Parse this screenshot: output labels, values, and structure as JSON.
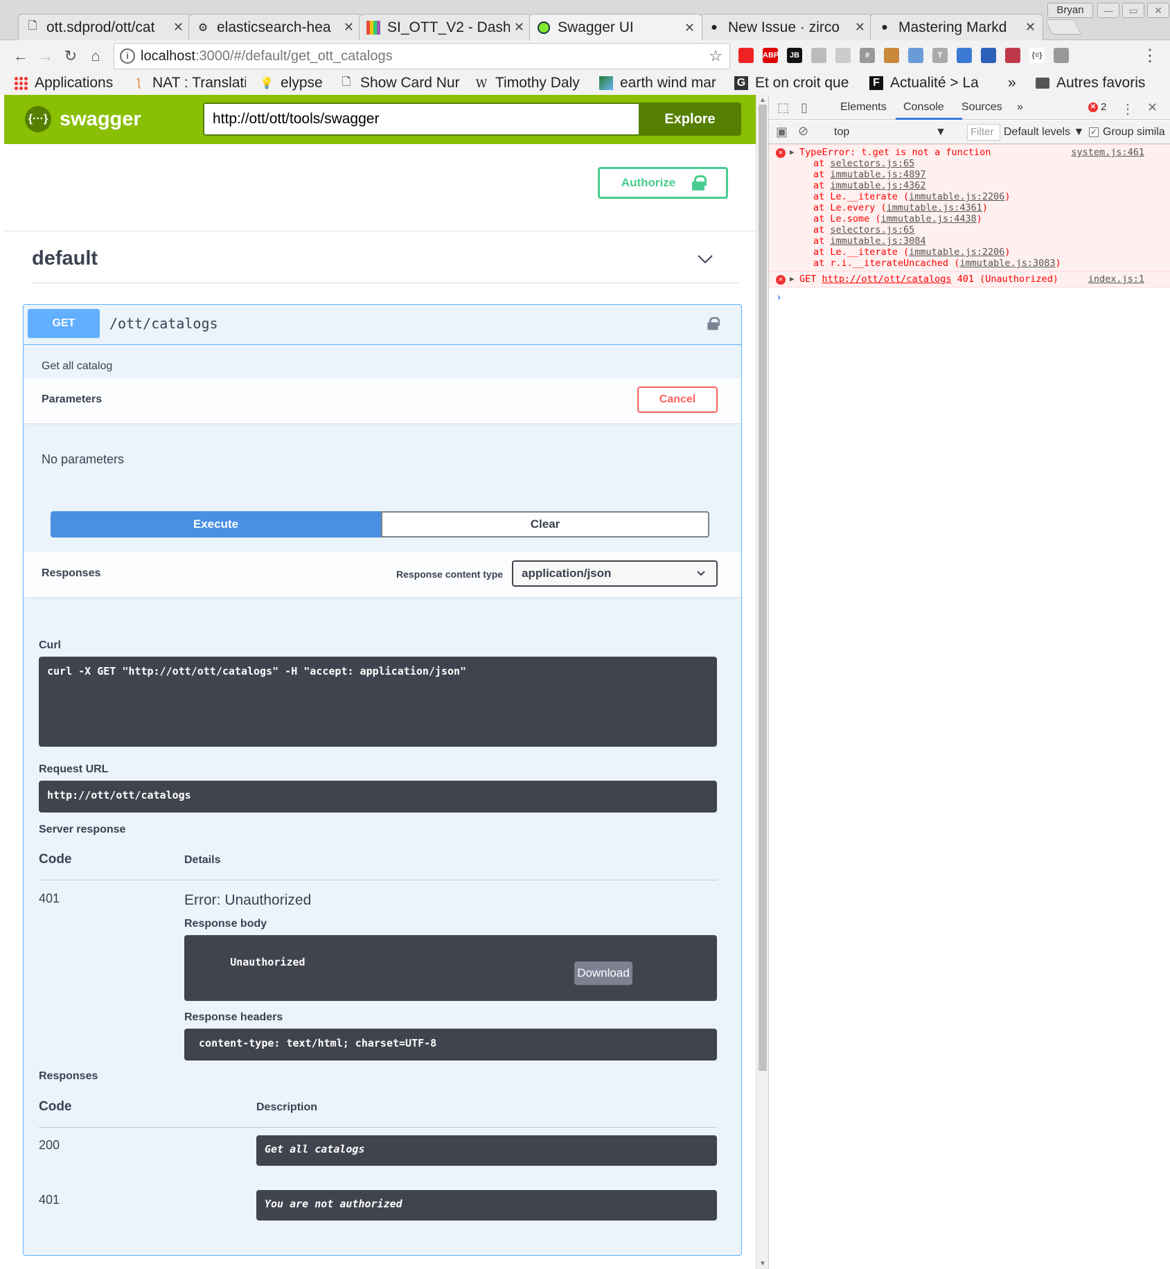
{
  "browser": {
    "tabs": [
      {
        "title": "ott.sdprod/ott/cat",
        "icon": "document-icon"
      },
      {
        "title": "elasticsearch-hea",
        "icon": "elasticsearch-icon"
      },
      {
        "title": "SI_OTT_V2 - Dash",
        "icon": "dashboard-icon"
      },
      {
        "title": "Swagger UI",
        "icon": "swagger-icon",
        "active": true
      },
      {
        "title": "New Issue · zirco",
        "icon": "github-icon"
      },
      {
        "title": "Mastering Markd",
        "icon": "github-icon"
      }
    ],
    "user": "Bryan",
    "address": {
      "host": "localhost",
      "path": ":3000/#/default/get_ott_catalogs"
    },
    "bookmarks": [
      {
        "label": "Applications",
        "icon": "apps-grid-icon"
      },
      {
        "label": "NAT : Translatio",
        "icon": "nat-icon"
      },
      {
        "label": "elypse",
        "icon": "bulb-icon"
      },
      {
        "label": "Show Card Nur",
        "icon": "document-icon"
      },
      {
        "label": "Timothy Daly",
        "icon": "wikipedia-icon"
      },
      {
        "label": "earth wind mar",
        "icon": "earth-icon"
      },
      {
        "label": "Et on croit que",
        "icon": "google-icon"
      },
      {
        "label": "Actualité > La",
        "icon": "f-icon"
      },
      {
        "label": "Autres favoris",
        "icon": "folder-icon"
      }
    ],
    "more_bookmarks": "»",
    "extensions": [
      {
        "label": "",
        "color": "#e22"
      },
      {
        "label": "ABP",
        "color": "#d00"
      },
      {
        "label": "JB",
        "color": "#111"
      },
      {
        "label": "",
        "color": "#bbb"
      },
      {
        "label": "",
        "color": "#ccc"
      },
      {
        "label": "#",
        "color": "#999"
      },
      {
        "label": "",
        "color": "#c8893a"
      },
      {
        "label": "",
        "color": "#6a9bd8"
      },
      {
        "label": "T",
        "color": "#aaa"
      },
      {
        "label": "",
        "color": "#3a7bd5"
      },
      {
        "label": "",
        "color": "#2c5fb8"
      },
      {
        "label": "",
        "color": "#c0394b"
      },
      {
        "label": "{≡}",
        "color": "#fff"
      },
      {
        "label": "",
        "color": "#999"
      }
    ]
  },
  "swagger": {
    "brand": "swagger",
    "spec_url": "http://ott/ott/tools/swagger",
    "explore_label": "Explore",
    "authorize_label": "Authorize",
    "tag": "default",
    "operation": {
      "method": "GET",
      "path": "/ott/catalogs",
      "summary": "Get all catalog",
      "parameters_title": "Parameters",
      "cancel_label": "Cancel",
      "no_params": "No parameters",
      "execute_label": "Execute",
      "clear_label": "Clear",
      "responses_title": "Responses",
      "response_content_type_label": "Response content type",
      "response_content_type": "application/json",
      "curl_label": "Curl",
      "curl": "curl -X GET \"http://ott/ott/catalogs\" -H \"accept: application/json\"",
      "request_url_label": "Request URL",
      "request_url": "http://ott/ott/catalogs",
      "server_response_label": "Server response",
      "code_header": "Code",
      "details_header": "Details",
      "server_code": "401",
      "server_error": "Error: Unauthorized",
      "response_body_label": "Response body",
      "response_body": "Unauthorized",
      "download_label": "Download",
      "response_headers_label": "Response headers",
      "response_headers": " content-type: text/html; charset=UTF-8 ",
      "responses_label": "Responses",
      "description_header": "Description",
      "responses": [
        {
          "code": "200",
          "description": "Get all catalogs"
        },
        {
          "code": "401",
          "description": "You are not authorized"
        }
      ]
    }
  },
  "devtools": {
    "tabs": [
      "Elements",
      "Console",
      "Sources"
    ],
    "more": "»",
    "error_count": "2",
    "context": "top",
    "filter_placeholder": "Filter",
    "levels": "Default levels ▼",
    "group_similar": "Group simila",
    "messages": [
      {
        "text": "TypeError: t.get is not a function",
        "source": "system.js:461",
        "stack": [
          [
            "at ",
            "selectors.js:65",
            ""
          ],
          [
            "at ",
            "immutable.js:4897",
            ""
          ],
          [
            "at ",
            "immutable.js:4362",
            ""
          ],
          [
            "at Le.__iterate (",
            "immutable.js:2206",
            ")"
          ],
          [
            "at Le.every (",
            "immutable.js:4361",
            ")"
          ],
          [
            "at Le.some (",
            "immutable.js:4438",
            ")"
          ],
          [
            "at ",
            "selectors.js:65",
            ""
          ],
          [
            "at ",
            "immutable.js:3084",
            ""
          ],
          [
            "at Le.__iterate (",
            "immutable.js:2206",
            ")"
          ],
          [
            "at r.i.__iterateUncached (",
            "immutable.js:3083",
            ")"
          ]
        ]
      },
      {
        "prefix": "GET ",
        "url": "http://ott/ott/catalogs",
        "text": " 401 (Unauthorized)",
        "source": "index.js:1"
      }
    ],
    "prompt": "›"
  }
}
